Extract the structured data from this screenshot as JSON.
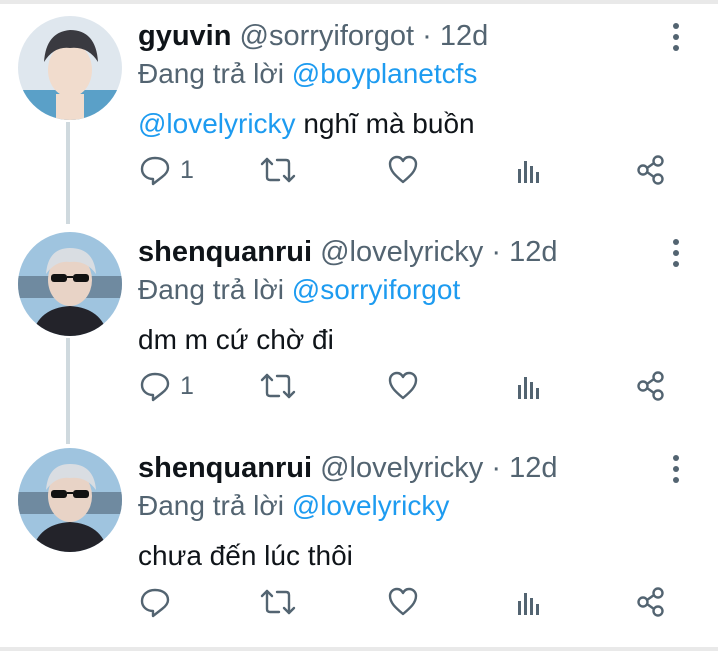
{
  "colors": {
    "link": "#1d9bf0",
    "muted": "#536471",
    "text": "#0f1419",
    "thread_line": "#cfd9de"
  },
  "tweets": [
    {
      "name": "gyuvin",
      "handle": "@sorryiforgot",
      "separator": "·",
      "time": "12d",
      "reply_prefix": "Đang trả lời",
      "reply_to": "@boyplanetcfs",
      "body_mention": "@lovelyricky",
      "body_text": " nghĩ mà buồn",
      "reply_count": "1",
      "icons": [
        "reply-icon",
        "retweet-icon",
        "like-icon",
        "views-icon",
        "share-icon"
      ]
    },
    {
      "name": "shenquanrui",
      "handle": "@lovelyricky",
      "separator": "·",
      "time": "12d",
      "reply_prefix": "Đang trả lời",
      "reply_to": "@sorryiforgot",
      "body_mention": "",
      "body_text": "dm m cứ chờ đi",
      "reply_count": "1",
      "icons": [
        "reply-icon",
        "retweet-icon",
        "like-icon",
        "views-icon",
        "share-icon"
      ]
    },
    {
      "name": "shenquanrui",
      "handle": "@lovelyricky",
      "separator": "·",
      "time": "12d",
      "reply_prefix": "Đang trả lời",
      "reply_to": "@lovelyricky",
      "body_mention": "",
      "body_text": "chưa đến lúc thôi",
      "reply_count": "",
      "icons": [
        "reply-icon",
        "retweet-icon",
        "like-icon",
        "views-icon",
        "share-icon"
      ]
    }
  ]
}
